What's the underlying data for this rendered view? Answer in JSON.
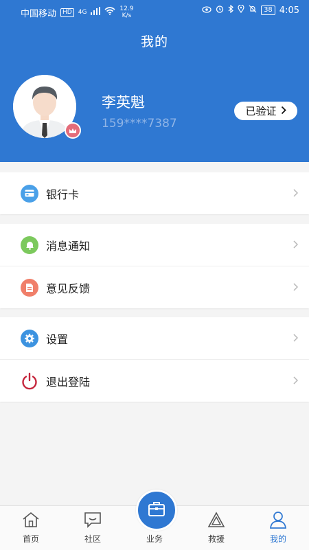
{
  "status_bar": {
    "carrier": "中国移动",
    "hd": "HD",
    "network": "4G",
    "speed_value": "12.9",
    "speed_unit": "K/s",
    "battery": "38",
    "time": "4:05"
  },
  "header": {
    "title": "我的",
    "user_name": "李英魁",
    "phone": "159****7387",
    "verified_label": "已验证"
  },
  "menu_groups": [
    [
      {
        "label": "银行卡",
        "icon": "bank-card-icon"
      }
    ],
    [
      {
        "label": "消息通知",
        "icon": "bell-icon"
      },
      {
        "label": "意见反馈",
        "icon": "feedback-icon"
      }
    ],
    [
      {
        "label": "设置",
        "icon": "gear-icon"
      },
      {
        "label": "退出登陆",
        "icon": "power-icon"
      }
    ]
  ],
  "tabs": [
    {
      "label": "首页",
      "icon": "home-icon"
    },
    {
      "label": "社区",
      "icon": "chat-icon"
    },
    {
      "label": "业务",
      "icon": "briefcase-icon"
    },
    {
      "label": "救援",
      "icon": "triangle-icon"
    },
    {
      "label": "我的",
      "icon": "person-icon"
    }
  ],
  "active_tab": "我的",
  "colors": {
    "primary": "#2f78d2",
    "bank_icon": "#4aa0e8",
    "bell_icon": "#7cc95d",
    "feedback_icon": "#f07f6a",
    "gear_icon": "#3d93e0",
    "power_icon": "#c5263c",
    "vip_badge": "#e46c7a"
  }
}
